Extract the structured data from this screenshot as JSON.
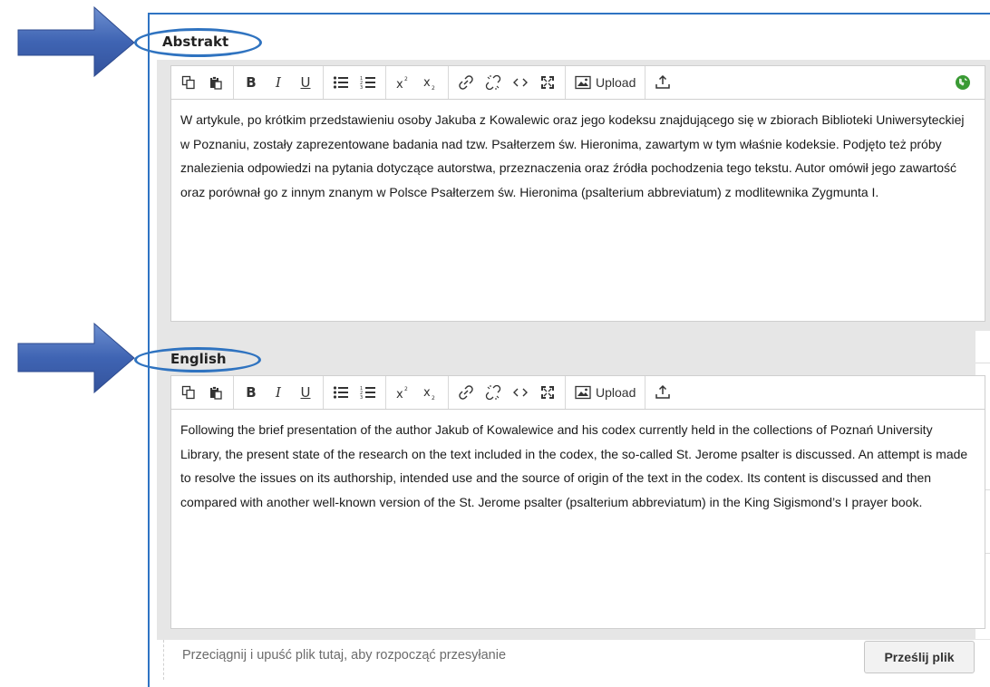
{
  "abstract_field": {
    "label": "Abstrakt",
    "content": "W artykule, po krótkim przedstawieniu osoby Jakuba z Kowalewic oraz jego kodeksu znajdującego się w zbiorach Biblioteki Uniwersyteckiej w Poznaniu, zostały zaprezentowane badania nad tzw. Psałterzem św. Hieronima, zawartym w tym właśnie kodeksie. Podjęto też próby znalezienia odpowiedzi na pytania dotyczące autorstwa, przeznaczenia oraz źródła pochodzenia tego tekstu. Autor omówił jego zawartość oraz porównał go z innym znanym w Polsce Psałterzem św. Hieronima (psalterium abbreviatum) z modlitewnika Zygmunta I."
  },
  "english_field": {
    "label": "English",
    "content": "Following the brief presentation of the author Jakub of Kowalewice and his codex currently held in the collections of Poznań University Library, the present state of the research on the text included in the codex, the so-called St. Jerome psalter is discussed. An attempt is made to resolve the issues on its authorship, intended use and the source of origin of the text in the codex. Its content is discussed and then compared with another well-known version of the St. Jerome psalter (psalterium abbreviatum) in the King Sigismond’s I prayer book."
  },
  "toolbar": {
    "bold": "B",
    "italic": "I",
    "underline": "U",
    "upload_label": "Upload",
    "icons": [
      "copy-icon",
      "paste-icon",
      "bold-icon",
      "italic-icon",
      "underline-icon",
      "bullet-list-icon",
      "numbered-list-icon",
      "superscript-icon",
      "subscript-icon",
      "link-icon",
      "unlink-icon",
      "code-icon",
      "fullscreen-icon",
      "image-upload-icon",
      "insert-file-icon",
      "globe-icon"
    ]
  },
  "dropzone": {
    "text": "Przeciągnij i upuść plik tutaj, aby rozpocząć przesyłanie",
    "button_label": "Prześlij plik"
  },
  "colors": {
    "annotation_blue": "#2f73c0",
    "arrow_fill": "#3f64b3",
    "globe_green": "#3a9a34",
    "panel_grey": "#e6e6e6"
  }
}
